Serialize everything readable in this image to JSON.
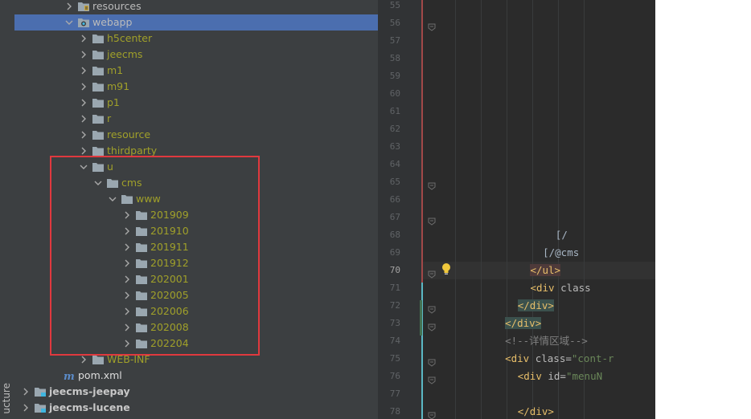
{
  "sidebar": {
    "label": "ucture"
  },
  "tree": {
    "rows": [
      {
        "label": "resources",
        "indent": 5,
        "chevron": "right",
        "icon": "resources-folder",
        "style": "normal"
      },
      {
        "label": "webapp",
        "indent": 5,
        "chevron": "down",
        "icon": "web-folder",
        "style": "normal",
        "selected": true
      },
      {
        "label": "h5center",
        "indent": 6,
        "chevron": "right",
        "icon": "folder",
        "style": "olive"
      },
      {
        "label": "jeecms",
        "indent": 6,
        "chevron": "right",
        "icon": "folder",
        "style": "olive"
      },
      {
        "label": "m1",
        "indent": 6,
        "chevron": "right",
        "icon": "folder",
        "style": "olive"
      },
      {
        "label": "m91",
        "indent": 6,
        "chevron": "right",
        "icon": "folder",
        "style": "olive"
      },
      {
        "label": "p1",
        "indent": 6,
        "chevron": "right",
        "icon": "folder",
        "style": "olive"
      },
      {
        "label": "r",
        "indent": 6,
        "chevron": "right",
        "icon": "folder",
        "style": "olive"
      },
      {
        "label": "resource",
        "indent": 6,
        "chevron": "right",
        "icon": "folder",
        "style": "olive"
      },
      {
        "label": "thirdparty",
        "indent": 6,
        "chevron": "right",
        "icon": "folder",
        "style": "olive"
      },
      {
        "label": "u",
        "indent": 6,
        "chevron": "down",
        "icon": "folder",
        "style": "olive"
      },
      {
        "label": "cms",
        "indent": 7,
        "chevron": "down",
        "icon": "folder",
        "style": "olive"
      },
      {
        "label": "www",
        "indent": 8,
        "chevron": "down",
        "icon": "folder",
        "style": "olive"
      },
      {
        "label": "201909",
        "indent": 9,
        "chevron": "right",
        "icon": "folder",
        "style": "olive"
      },
      {
        "label": "201910",
        "indent": 9,
        "chevron": "right",
        "icon": "folder",
        "style": "olive"
      },
      {
        "label": "201911",
        "indent": 9,
        "chevron": "right",
        "icon": "folder",
        "style": "olive"
      },
      {
        "label": "201912",
        "indent": 9,
        "chevron": "right",
        "icon": "folder",
        "style": "olive"
      },
      {
        "label": "202001",
        "indent": 9,
        "chevron": "right",
        "icon": "folder",
        "style": "olive"
      },
      {
        "label": "202005",
        "indent": 9,
        "chevron": "right",
        "icon": "folder",
        "style": "olive"
      },
      {
        "label": "202006",
        "indent": 9,
        "chevron": "right",
        "icon": "folder",
        "style": "olive"
      },
      {
        "label": "202008",
        "indent": 9,
        "chevron": "right",
        "icon": "folder",
        "style": "olive"
      },
      {
        "label": "202204",
        "indent": 9,
        "chevron": "right",
        "icon": "folder",
        "style": "olive"
      },
      {
        "label": "WEB-INF",
        "indent": 6,
        "chevron": "right",
        "icon": "folder",
        "style": "olive"
      },
      {
        "label": "pom.xml",
        "indent": 4,
        "chevron": "none",
        "icon": "maven-file",
        "style": "white"
      },
      {
        "label": "jeecms-jeepay",
        "indent": 2,
        "chevron": "right",
        "icon": "module-folder",
        "style": "bold"
      },
      {
        "label": "jeecms-lucene",
        "indent": 2,
        "chevron": "right",
        "icon": "module-folder",
        "style": "bold"
      }
    ]
  },
  "editor": {
    "current_line": "70",
    "lines": [
      {
        "no": "55",
        "fold": false,
        "code": []
      },
      {
        "no": "56",
        "fold": true,
        "code": []
      },
      {
        "no": "57",
        "fold": false,
        "code": []
      },
      {
        "no": "58",
        "fold": false,
        "code": []
      },
      {
        "no": "59",
        "fold": false,
        "code": []
      },
      {
        "no": "60",
        "fold": false,
        "code": []
      },
      {
        "no": "61",
        "fold": false,
        "code": []
      },
      {
        "no": "62",
        "fold": false,
        "code": []
      },
      {
        "no": "63",
        "fold": false,
        "code": []
      },
      {
        "no": "64",
        "fold": false,
        "code": []
      },
      {
        "no": "65",
        "fold": true,
        "code": []
      },
      {
        "no": "66",
        "fold": false,
        "code": []
      },
      {
        "no": "67",
        "fold": true,
        "code": []
      },
      {
        "no": "68",
        "fold": false,
        "indent": 40,
        "code": [
          {
            "t": "[/",
            "c": "plain"
          }
        ]
      },
      {
        "no": "69",
        "fold": false,
        "indent": 36,
        "code": [
          {
            "t": "[/@cms",
            "c": "plain"
          }
        ]
      },
      {
        "no": "70",
        "fold": true,
        "indent": 32,
        "code": [
          {
            "t": "</ul>",
            "c": "tag-red"
          }
        ]
      },
      {
        "no": "71",
        "fold": false,
        "indent": 32,
        "code": [
          {
            "t": "<div",
            "c": "tag"
          },
          {
            "t": " class",
            "c": "attr"
          }
        ]
      },
      {
        "no": "72",
        "fold": true,
        "indent": 28,
        "code": [
          {
            "t": "</div>",
            "c": "tag-bg"
          }
        ]
      },
      {
        "no": "73",
        "fold": true,
        "indent": 24,
        "code": [
          {
            "t": "</div>",
            "c": "tag-bg"
          }
        ]
      },
      {
        "no": "74",
        "fold": false,
        "indent": 24,
        "code": [
          {
            "t": "<!--详情区域-->",
            "c": "cmt"
          }
        ]
      },
      {
        "no": "75",
        "fold": true,
        "indent": 24,
        "code": [
          {
            "t": "<div",
            "c": "tag"
          },
          {
            "t": " class=",
            "c": "attr"
          },
          {
            "t": "\"cont-r",
            "c": "str"
          }
        ]
      },
      {
        "no": "76",
        "fold": true,
        "indent": 28,
        "code": [
          {
            "t": "<div",
            "c": "tag"
          },
          {
            "t": " id=",
            "c": "attr"
          },
          {
            "t": "\"menuN",
            "c": "str"
          }
        ]
      },
      {
        "no": "77",
        "fold": false,
        "code": []
      },
      {
        "no": "78",
        "fold": true,
        "indent": 28,
        "code": [
          {
            "t": "</div>",
            "c": "tag"
          }
        ]
      }
    ]
  },
  "colors": {
    "panel_bg": "#3c3f41",
    "selected_row": "#4b6eaf",
    "folder_label": "#a0a02a",
    "highlight_box": "#e0393e",
    "editor_bg": "#2b2b2b"
  }
}
